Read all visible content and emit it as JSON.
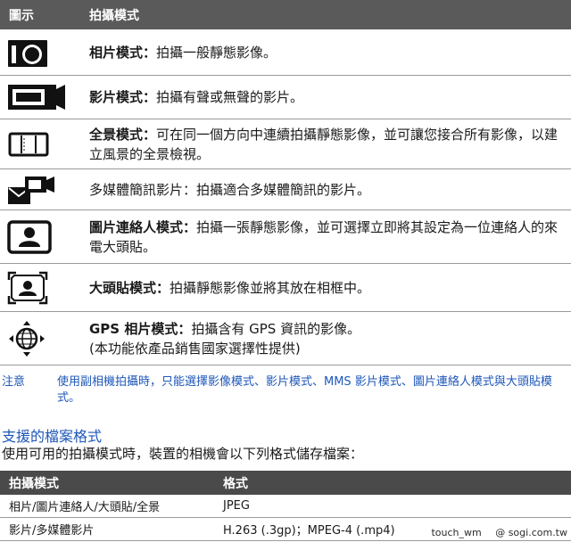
{
  "mode_table": {
    "headers": {
      "icon": "圖示",
      "mode": "拍攝模式"
    },
    "rows": [
      {
        "icon": "camera-icon",
        "name": "相片模式",
        "sep": "：",
        "desc": "拍攝一般靜態影像。"
      },
      {
        "icon": "video-camera-icon",
        "name": "影片模式",
        "sep": "：",
        "desc": "拍攝有聲或無聲的影片。"
      },
      {
        "icon": "panorama-icon",
        "name": "全景模式",
        "sep": "：",
        "desc": "可在同一個方向中連續拍攝靜態影像，並可讓您接合所有影像，以建立風景的全景檢視。"
      },
      {
        "icon": "mms-video-icon",
        "name": "多媒體簡訊影片",
        "sep": "：",
        "desc": "拍攝適合多媒體簡訊的影片。"
      },
      {
        "icon": "contact-picture-icon",
        "name": "圖片連絡人模式",
        "sep": "：",
        "desc": "拍攝一張靜態影像，並可選擇立即將其設定為一位連絡人的來電大頭貼。"
      },
      {
        "icon": "picture-frame-icon",
        "name": "大頭貼模式",
        "sep": "：",
        "desc": "拍攝靜態影像並將其放在相框中。"
      },
      {
        "icon": "gps-globe-icon",
        "name": "GPS 相片模式",
        "sep": "：",
        "desc": "拍攝含有 GPS 資訊的影像。",
        "desc2": "(本功能依產品銷售國家選擇性提供)"
      }
    ]
  },
  "note": {
    "label": "注意",
    "text": "使用副相機拍攝時，只能選擇影像模式、影片模式、MMS 影片模式、圖片連絡人模式與大頭貼模式。"
  },
  "formats": {
    "title": "支援的檔案格式",
    "intro": "使用可用的拍攝模式時，裝置的相機會以下列格式儲存檔案：",
    "headers": {
      "mode": "拍攝模式",
      "format": "格式"
    },
    "rows": [
      {
        "mode": "相片/圖片連絡人/大頭貼/全景",
        "format": "JPEG"
      },
      {
        "mode": "影片/多媒體影片",
        "format": "H.263 (.3gp)；MPEG-4 (.mp4)"
      }
    ]
  },
  "watermark": {
    "left": "touch_wm",
    "right": "@ sogi.com.tw"
  }
}
